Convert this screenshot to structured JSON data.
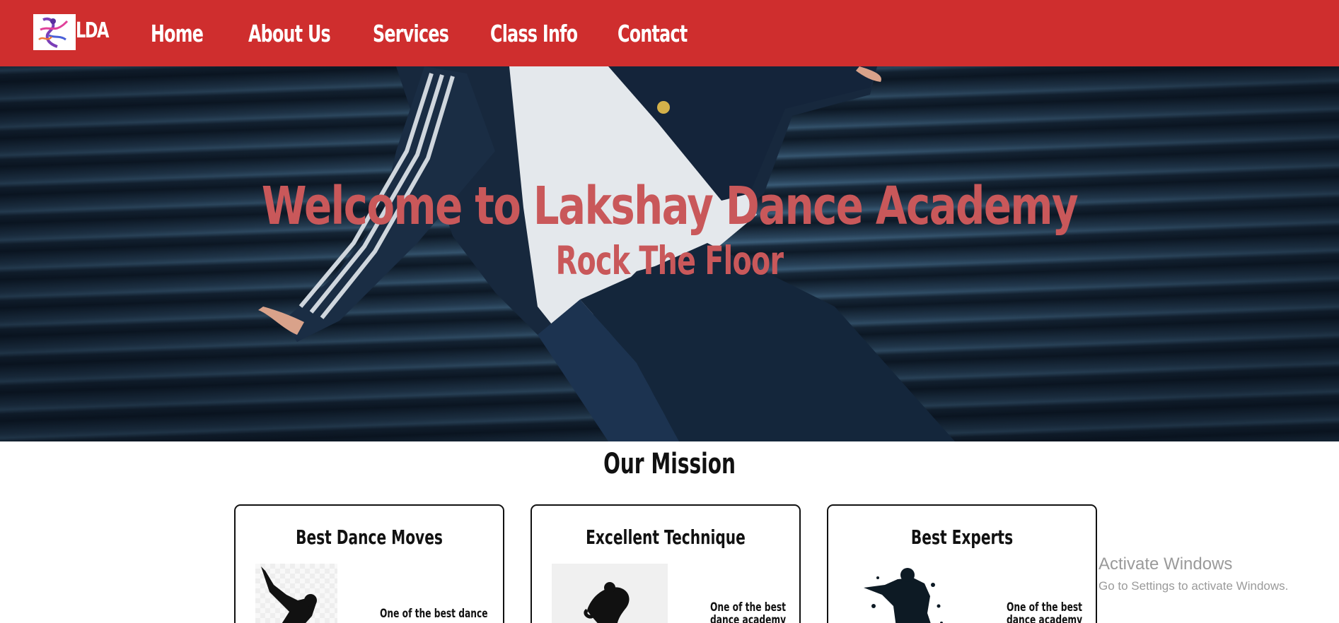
{
  "header": {
    "logo_text": "LDA",
    "nav": [
      {
        "label": "Home"
      },
      {
        "label": "About Us"
      },
      {
        "label": "Services"
      },
      {
        "label": "Class Info"
      },
      {
        "label": "Contact"
      }
    ]
  },
  "hero": {
    "title": "Welcome to Lakshay Dance Academy",
    "subtitle": "Rock The Floor"
  },
  "mission": {
    "title": "Our Mission",
    "cards": [
      {
        "title": "Best Dance Moves",
        "text_line1": "One of the best dance",
        "text_line2": ""
      },
      {
        "title": "Excellent Technique",
        "text_line1": "One of the best",
        "text_line2": "dance academy"
      },
      {
        "title": "Best Experts",
        "text_line1": "One of the best",
        "text_line2": "dance academy"
      }
    ]
  },
  "os_watermark": {
    "title": "Activate Windows",
    "subtitle": "Go to Settings to activate Windows."
  },
  "colors": {
    "nav_bg": "#cf2e2e",
    "hero_text": "#c9585a",
    "text": "#111111"
  }
}
